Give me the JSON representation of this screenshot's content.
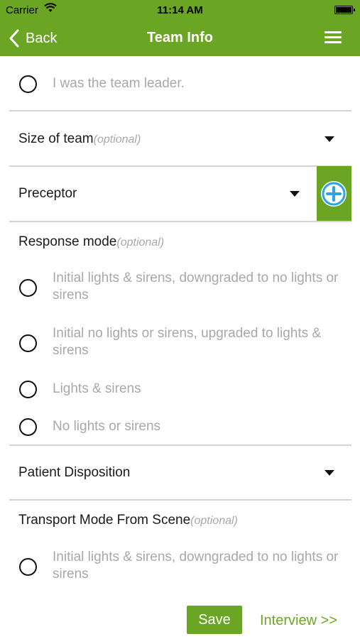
{
  "status_bar": {
    "carrier": "Carrier",
    "time": "11:14 AM"
  },
  "nav": {
    "back_label": "Back",
    "title": "Team Info"
  },
  "team_leader_option": "I was the team leader.",
  "size_of_team": {
    "label": "Size of team",
    "optional": "(optional)"
  },
  "preceptor": {
    "label": "Preceptor"
  },
  "response_mode": {
    "label": "Response mode",
    "optional": "(optional)",
    "options": [
      "Initial lights & sirens, downgraded to no lights or sirens",
      "Initial no lights or sirens, upgraded to lights & sirens",
      "Lights & sirens",
      "No lights or sirens"
    ]
  },
  "patient_disposition": {
    "label": "Patient Disposition"
  },
  "transport_mode": {
    "label": "Transport Mode From Scene",
    "optional": "(optional)",
    "options": [
      "Initial lights & sirens, downgraded to no lights or sirens"
    ]
  },
  "footer": {
    "save_label": "Save",
    "interview_label": "Interview >>"
  },
  "colors": {
    "brand_green": "#6aa524",
    "add_icon_blue": "#2ea3e0",
    "placeholder_gray": "#a8a8a8"
  },
  "icons": [
    "wifi-icon",
    "battery-icon",
    "chevron-left-icon",
    "hamburger-menu-icon",
    "caret-down-icon",
    "add-circle-icon",
    "radio-unchecked-icon"
  ]
}
